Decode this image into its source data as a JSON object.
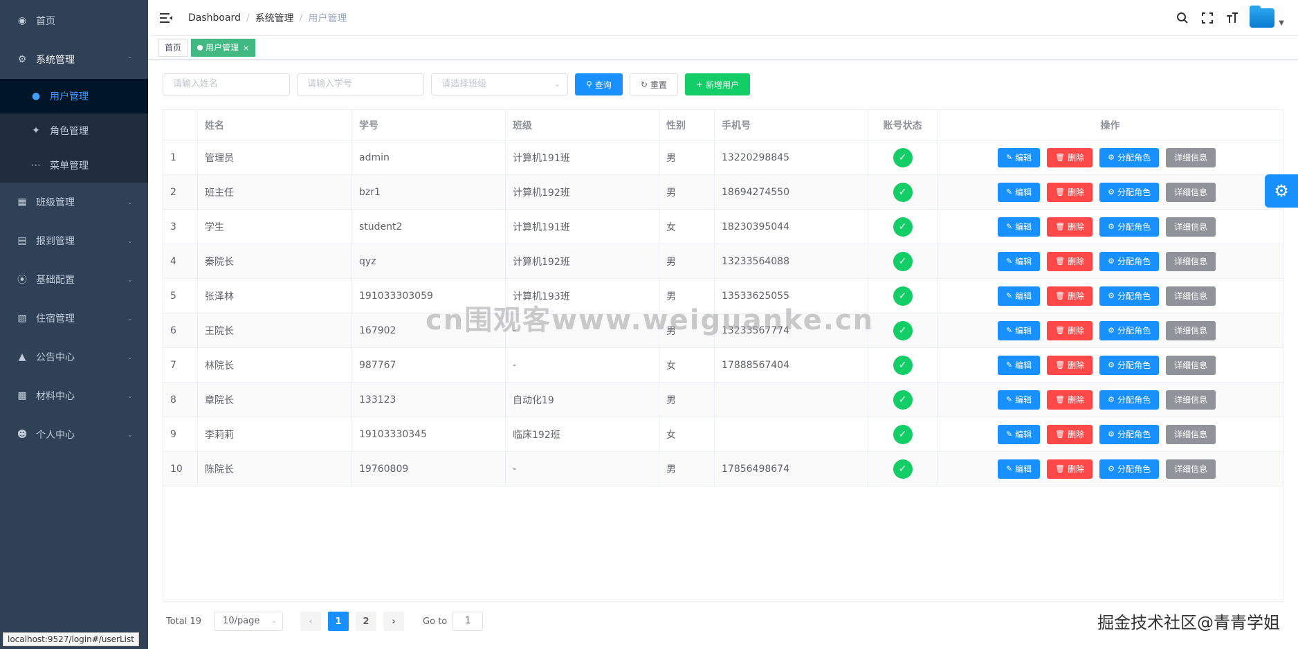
{
  "sidebar": {
    "items": [
      {
        "label": "首页",
        "icon": "dashboard-icon"
      },
      {
        "label": "系统管理",
        "icon": "gear-icon"
      },
      {
        "label": "用户管理",
        "icon": "user-icon"
      },
      {
        "label": "角色管理",
        "icon": "bulb-icon"
      },
      {
        "label": "菜单管理",
        "icon": "dots-icon"
      },
      {
        "label": "班级管理",
        "icon": "grid-icon"
      },
      {
        "label": "报到管理",
        "icon": "monitor-icon"
      },
      {
        "label": "基础配置",
        "icon": "circle-icon"
      },
      {
        "label": "住宿管理",
        "icon": "building-icon"
      },
      {
        "label": "公告中心",
        "icon": "bell-icon"
      },
      {
        "label": "材料中心",
        "icon": "clipboard-icon"
      },
      {
        "label": "个人中心",
        "icon": "person-icon"
      }
    ]
  },
  "navbar": {
    "breadcrumb": [
      "Dashboard",
      "系统管理",
      "用户管理"
    ]
  },
  "tags": {
    "home": "首页",
    "active": "用户管理",
    "close": "×"
  },
  "filter": {
    "name_placeholder": "请输入姓名",
    "id_placeholder": "请输入学号",
    "class_placeholder": "请选择班级",
    "search": "查询",
    "reset": "重置",
    "add": "新增用户"
  },
  "table": {
    "headers": [
      "",
      "姓名",
      "学号",
      "班级",
      "性别",
      "手机号",
      "账号状态",
      "操作"
    ],
    "actions": [
      "编辑",
      "删除",
      "分配角色",
      "详细信息"
    ],
    "rows": [
      {
        "idx": "1",
        "name": "管理员",
        "id": "admin",
        "class": "计算机191班",
        "sex": "男",
        "phone": "13220298845"
      },
      {
        "idx": "2",
        "name": "班主任",
        "id": "bzr1",
        "class": "计算机192班",
        "sex": "男",
        "phone": "18694274550"
      },
      {
        "idx": "3",
        "name": "学生",
        "id": "student2",
        "class": "计算机191班",
        "sex": "女",
        "phone": "18230395044"
      },
      {
        "idx": "4",
        "name": "秦院长",
        "id": "qyz",
        "class": "计算机192班",
        "sex": "男",
        "phone": "13233564088"
      },
      {
        "idx": "5",
        "name": "张泽林",
        "id": "191033303059",
        "class": "计算机193班",
        "sex": "男",
        "phone": "13533625055"
      },
      {
        "idx": "6",
        "name": "王院长",
        "id": "167902",
        "class": "-",
        "sex": "男",
        "phone": "13233567774"
      },
      {
        "idx": "7",
        "name": "林院长",
        "id": "987767",
        "class": "-",
        "sex": "女",
        "phone": "17888567404"
      },
      {
        "idx": "8",
        "name": "章院长",
        "id": "133123",
        "class": "自动化19",
        "sex": "男",
        "phone": ""
      },
      {
        "idx": "9",
        "name": "李莉莉",
        "id": "19103330345",
        "class": "临床192班",
        "sex": "女",
        "phone": ""
      },
      {
        "idx": "10",
        "name": "陈院长",
        "id": "19760809",
        "class": "-",
        "sex": "男",
        "phone": "17856498674"
      }
    ]
  },
  "pagination": {
    "total": "Total 19",
    "size": "10/page",
    "pages": [
      "1",
      "2"
    ],
    "goto_label": "Go to",
    "goto_value": "1"
  },
  "overlay": {
    "watermark": "cn围观客www.weiguanke.cn",
    "credit": "掘金技术社区@青青学姐",
    "status_url": "localhost:9527/login#/userList"
  },
  "colors": {
    "sidebar_bg": "#304156",
    "primary": "#1890ff",
    "success": "#13ce66",
    "danger": "#ff4949",
    "info": "#909399",
    "tag_active": "#42b983"
  }
}
